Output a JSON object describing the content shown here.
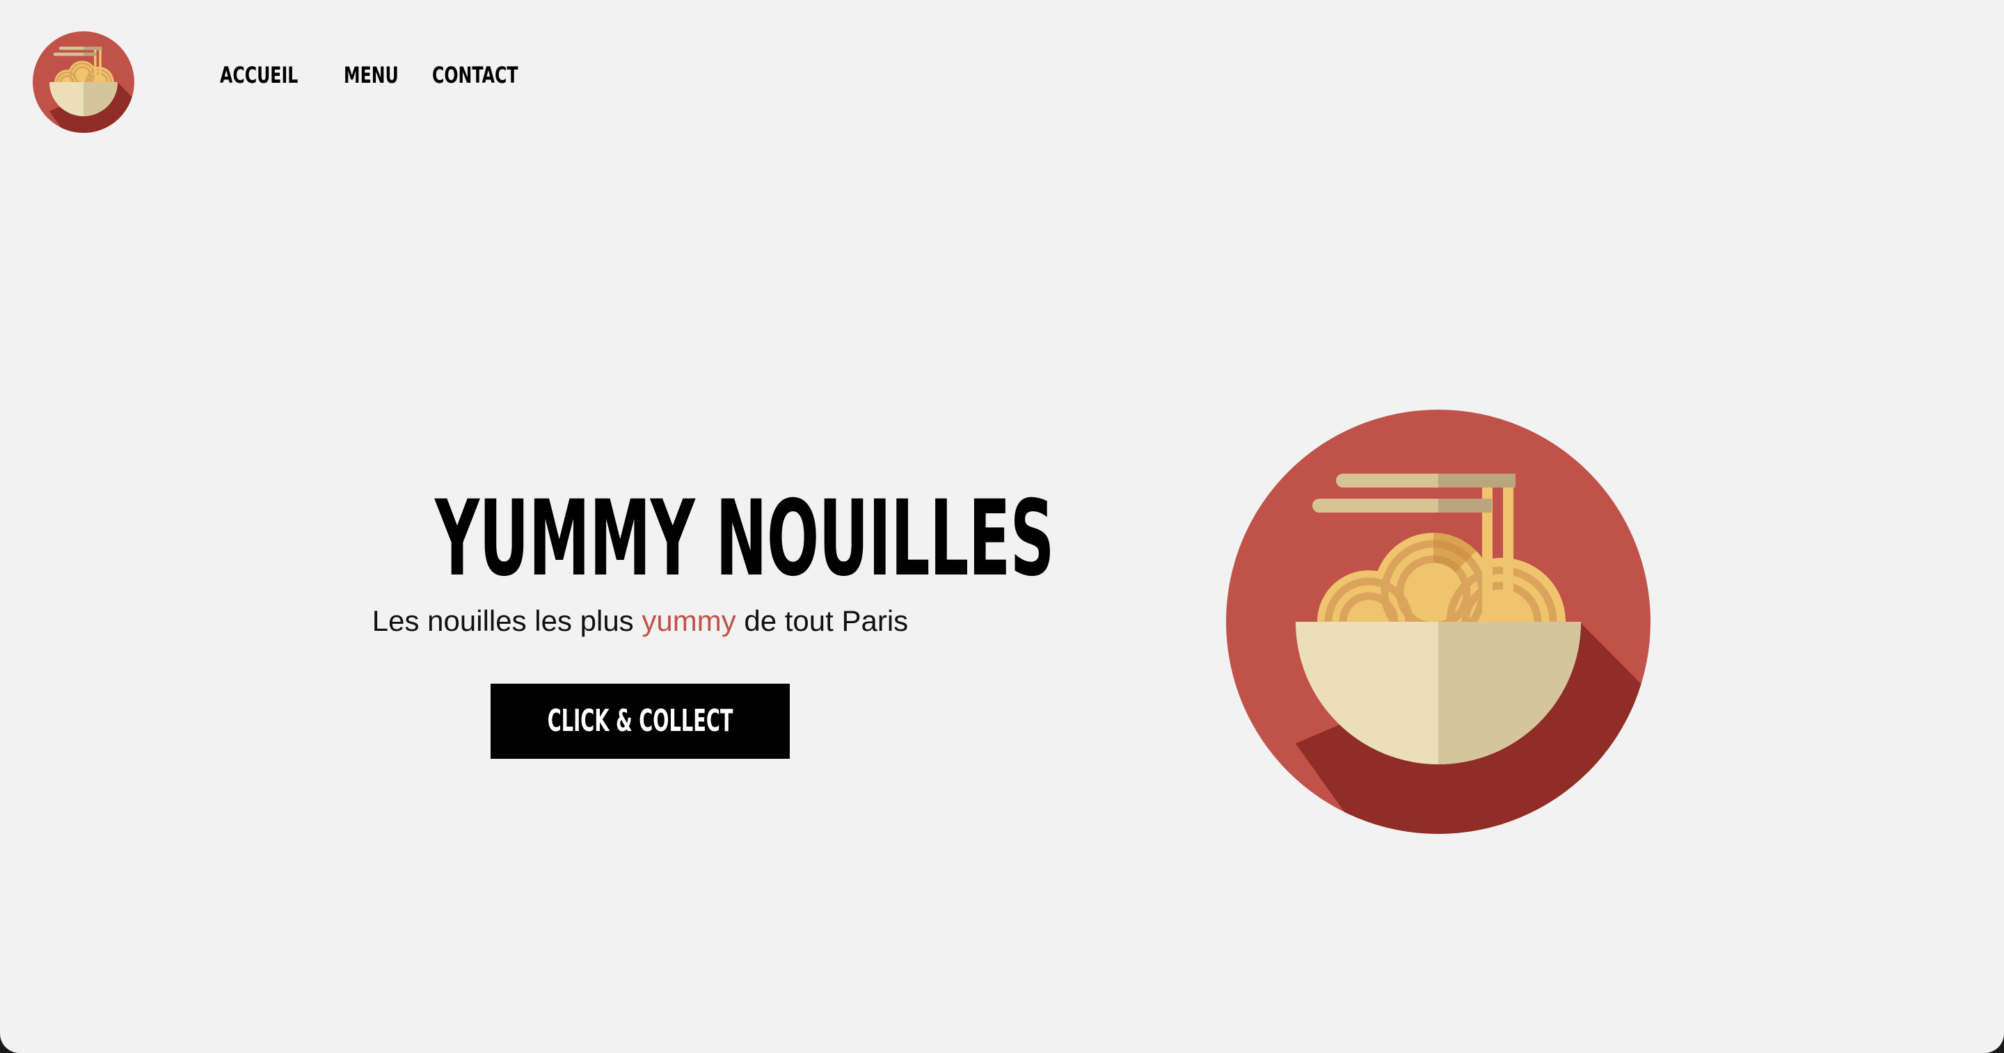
{
  "header": {
    "logo_icon": "noodle-bowl-icon",
    "nav": {
      "accueil": "ACCUEIL",
      "menu": "MENU",
      "contact": "CONTACT"
    }
  },
  "hero": {
    "title": "YUMMY NOUILLES",
    "subtitle_before": "Les nouilles les plus",
    "subtitle_highlight": "yummy",
    "subtitle_after": "de tout Paris",
    "cta_label": "CLICK & COLLECT",
    "image_icon": "noodle-bowl-icon"
  },
  "colors": {
    "background": "#f2f2f2",
    "brand_red": "#c0524a",
    "shadow_red": "#8f2d26",
    "bowl_light": "#ebdfb9",
    "bowl_dark": "#d4c59d",
    "noodle": "#efc46d",
    "noodle_dark": "#daa45c",
    "button": "#000000",
    "text": "#000000"
  }
}
